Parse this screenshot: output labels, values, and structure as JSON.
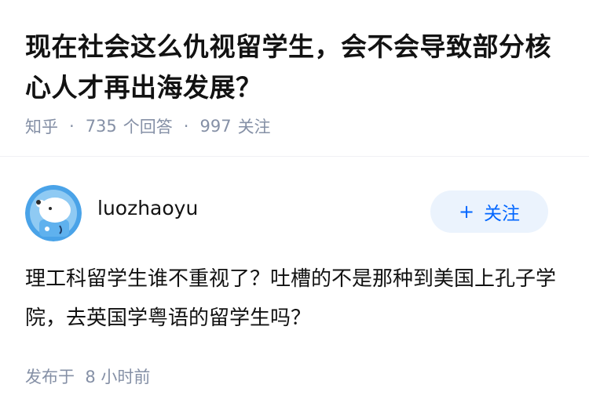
{
  "question": {
    "title": "现在社会这么仇视留学生，会不会导致部分核心人才再出海发展？",
    "source": "知乎",
    "answers_count": "735",
    "answers_label": "个回答",
    "followers_count": "997",
    "followers_label": "关注"
  },
  "answer": {
    "author": "luozhaoyu",
    "follow_label": "关注",
    "follow_icon": "plus-icon",
    "text": "理工科留学生谁不重视了？吐槽的不是那种到美国上孔子学院，去英国学粤语的留学生吗？",
    "published": "发布于  8 小时前"
  },
  "colors": {
    "accent": "#0066ff",
    "follow_bg": "#ebf3fd",
    "meta_text": "#8590a6",
    "primary_text": "#121212"
  }
}
